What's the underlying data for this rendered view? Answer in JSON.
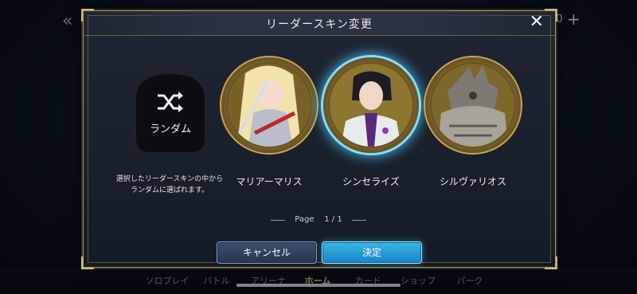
{
  "background": {
    "top_right_counter": "0",
    "nav": [
      {
        "label": "ソロプレイ"
      },
      {
        "label": "バトル"
      },
      {
        "label": "アリーナ"
      },
      {
        "label": "ホーム"
      },
      {
        "label": "カード"
      },
      {
        "label": "ショップ"
      },
      {
        "label": "パーク"
      }
    ]
  },
  "modal": {
    "title": "リーダースキン変更",
    "random": {
      "label": "ランダム",
      "description_line1": "選択したリーダースキンの中から",
      "description_line2": "ランダムに選ばれます。"
    },
    "skins": [
      {
        "name": "マリアーマリス",
        "selected": false
      },
      {
        "name": "シンセライズ",
        "selected": true
      },
      {
        "name": "シルヴァリオス",
        "selected": false
      }
    ],
    "pager": {
      "label": "Page",
      "current": "1",
      "separator": "/",
      "total": "1"
    },
    "cancel_label": "キャンセル",
    "confirm_label": "決定"
  },
  "colors": {
    "accent_gold": "#c9a65a",
    "selection_glow": "#7fe0ff",
    "confirm_blue": "#1f9ad8"
  }
}
